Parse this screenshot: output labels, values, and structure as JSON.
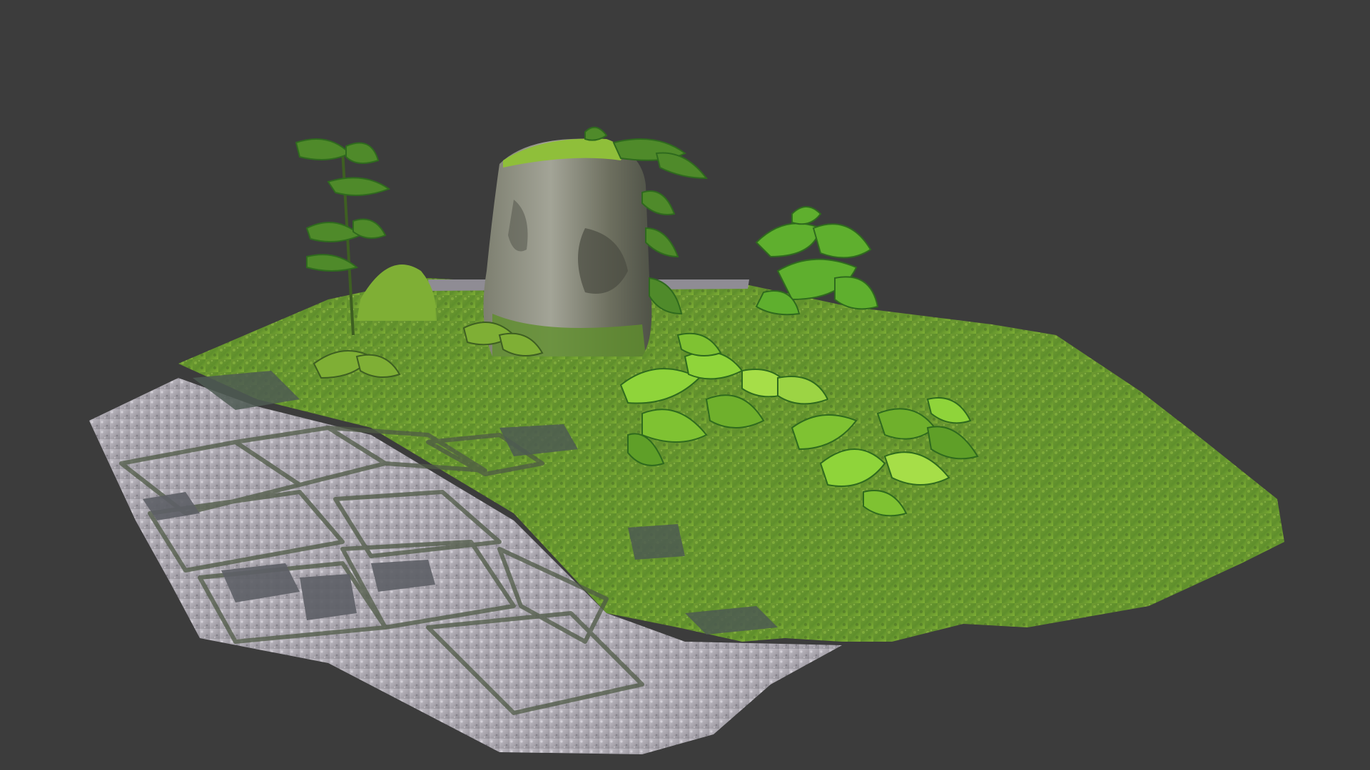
{
  "viewer": {
    "background_color": "#3c3c3c"
  },
  "scene": {
    "colors": {
      "stone_light": "#b7b3ba",
      "stone_mid": "#8f8c94",
      "stone_dark": "#5d5f66",
      "grout": "#4f5a46",
      "moss_light": "#8fbf3a",
      "moss_mid": "#5f8f2c",
      "moss_dark": "#3e5f22",
      "leaf_bright": "#8fd43a",
      "leaf_dark": "#2f6a1e",
      "rock_pale": "#a5a69a",
      "rock_dark": "#55574c",
      "water": "#4d5a52"
    }
  }
}
